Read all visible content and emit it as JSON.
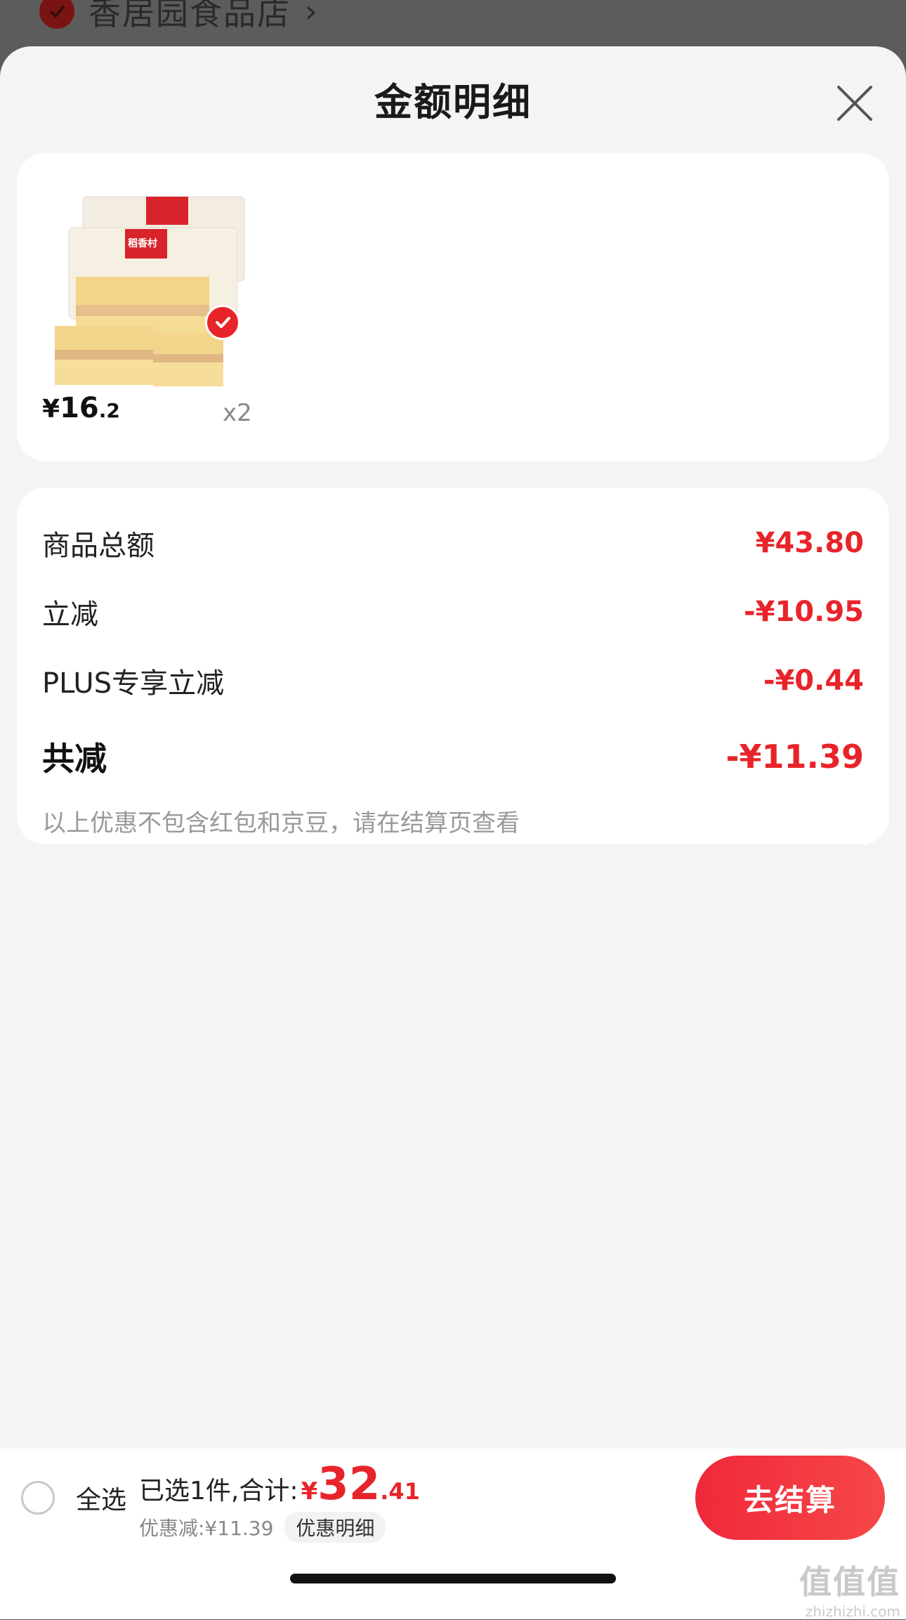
{
  "background": {
    "shop_name": "香居园食品店",
    "chevron": "›"
  },
  "sheet": {
    "title": "金额明细",
    "close_icon": "close-icon"
  },
  "product": {
    "brand_label": "稻香村",
    "price_currency": "¥",
    "price_integer": "16",
    "price_decimal": ".2",
    "quantity": "x2",
    "selected": true
  },
  "breakdown": {
    "rows": [
      {
        "label": "商品总额",
        "value": "¥43.80"
      },
      {
        "label": "立减",
        "value": "-¥10.95"
      },
      {
        "label": "PLUS专享立减",
        "value": "-¥0.44"
      }
    ],
    "total": {
      "label": "共减",
      "value": "-¥11.39"
    },
    "note": "以上优惠不包含红包和京豆，请在结算页查看"
  },
  "bottom_bar": {
    "select_all_label": "全选",
    "summary_text": "已选1件,合计:",
    "total_currency": "¥",
    "total_integer": "32",
    "total_decimal": ".41",
    "discount_text": "优惠减:¥11.39",
    "promo_detail_label": "优惠明细",
    "checkout_label": "去结算"
  },
  "watermark": {
    "logo": "值值值",
    "url": "zhizhizhi.com"
  },
  "colors": {
    "accent": "#e8242b",
    "sheet_bg": "#f4f4f4",
    "card_bg": "#ffffff"
  }
}
